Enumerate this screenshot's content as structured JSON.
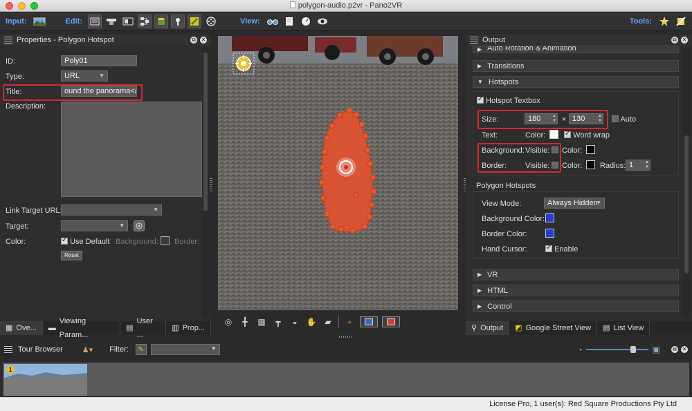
{
  "window": {
    "title": "polygon-audio.p2vr - Pano2VR"
  },
  "toolbar": {
    "input_label": "Input:",
    "edit_label": "Edit:",
    "view_label": "View:",
    "tools_label": "Tools:"
  },
  "properties": {
    "header": "Properties - Polygon Hotspot",
    "id_label": "ID:",
    "id_value": "Poly01",
    "type_label": "Type:",
    "type_value": "URL",
    "title_label": "Title:",
    "title_value": "ound the panorama</p>",
    "description_label": "Description:",
    "link_target_label": "Link Target URL:",
    "target_label": "Target:",
    "color_label": "Color:",
    "use_default_label": "Use Default",
    "background_label": "Background:",
    "border_label": "Border:",
    "reset_label": "Reset"
  },
  "left_tabs": [
    {
      "label": "Ove..."
    },
    {
      "label": "Viewing Param..."
    },
    {
      "label": "User ..."
    },
    {
      "label": "Prop..."
    }
  ],
  "output": {
    "header": "Output",
    "sections": {
      "auto_rotation": "Auto Rotation & Animation",
      "transitions": "Transitions",
      "hotspots": "Hotspots",
      "vr": "VR",
      "html": "HTML",
      "control": "Control"
    },
    "hotspot_textbox_label": "Hotspot Textbox",
    "size_label": "Size:",
    "size_width": "180",
    "size_x": "×",
    "size_height": "130",
    "auto_label": "Auto",
    "text_label": "Text:",
    "color_label": "Color:",
    "word_wrap_label": "Word wrap",
    "background_label": "Background:",
    "visible_label": "Visible:",
    "border_label": "Border:",
    "radius_label": "Radius:",
    "radius_value": "1",
    "polygon_hotspots_label": "Polygon Hotspots",
    "view_mode_label": "View Mode:",
    "view_mode_value": "Always Hidden",
    "background_color_label": "Background Color:",
    "border_color_label": "Border Color:",
    "hand_cursor_label": "Hand Cursor:",
    "enable_label": "Enable",
    "colors": {
      "blue": "#1f3fd6",
      "white": "#ffffff",
      "black": "#000000",
      "hotspot": "#e8532c"
    }
  },
  "right_tabs": [
    {
      "label": "Output"
    },
    {
      "label": "Google Street View"
    },
    {
      "label": "List View"
    }
  ],
  "tour_browser": {
    "header": "Tour Browser",
    "filter_label": "Filter:",
    "thumb_badge": "1"
  },
  "status": {
    "text": "License Pro, 1 user(s): Red Square Productions Pty Ltd"
  }
}
